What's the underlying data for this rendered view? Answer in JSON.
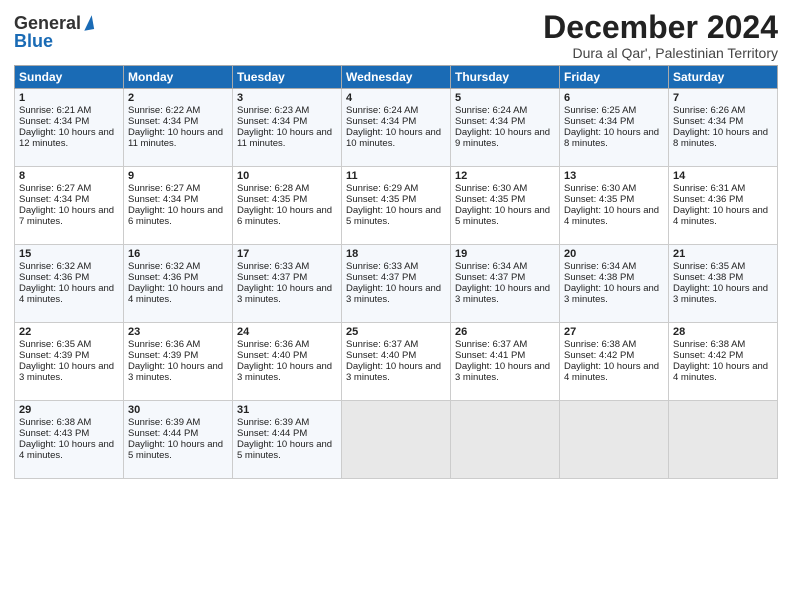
{
  "logo": {
    "general": "General",
    "blue": "Blue"
  },
  "title": {
    "month": "December 2024",
    "location": "Dura al Qar', Palestinian Territory"
  },
  "days_of_week": [
    "Sunday",
    "Monday",
    "Tuesday",
    "Wednesday",
    "Thursday",
    "Friday",
    "Saturday"
  ],
  "weeks": [
    [
      {
        "day": 1,
        "sunrise": "6:21 AM",
        "sunset": "4:34 PM",
        "daylight": "10 hours and 12 minutes."
      },
      {
        "day": 2,
        "sunrise": "6:22 AM",
        "sunset": "4:34 PM",
        "daylight": "10 hours and 11 minutes."
      },
      {
        "day": 3,
        "sunrise": "6:23 AM",
        "sunset": "4:34 PM",
        "daylight": "10 hours and 11 minutes."
      },
      {
        "day": 4,
        "sunrise": "6:24 AM",
        "sunset": "4:34 PM",
        "daylight": "10 hours and 10 minutes."
      },
      {
        "day": 5,
        "sunrise": "6:24 AM",
        "sunset": "4:34 PM",
        "daylight": "10 hours and 9 minutes."
      },
      {
        "day": 6,
        "sunrise": "6:25 AM",
        "sunset": "4:34 PM",
        "daylight": "10 hours and 8 minutes."
      },
      {
        "day": 7,
        "sunrise": "6:26 AM",
        "sunset": "4:34 PM",
        "daylight": "10 hours and 8 minutes."
      }
    ],
    [
      {
        "day": 8,
        "sunrise": "6:27 AM",
        "sunset": "4:34 PM",
        "daylight": "10 hours and 7 minutes."
      },
      {
        "day": 9,
        "sunrise": "6:27 AM",
        "sunset": "4:34 PM",
        "daylight": "10 hours and 6 minutes."
      },
      {
        "day": 10,
        "sunrise": "6:28 AM",
        "sunset": "4:35 PM",
        "daylight": "10 hours and 6 minutes."
      },
      {
        "day": 11,
        "sunrise": "6:29 AM",
        "sunset": "4:35 PM",
        "daylight": "10 hours and 5 minutes."
      },
      {
        "day": 12,
        "sunrise": "6:30 AM",
        "sunset": "4:35 PM",
        "daylight": "10 hours and 5 minutes."
      },
      {
        "day": 13,
        "sunrise": "6:30 AM",
        "sunset": "4:35 PM",
        "daylight": "10 hours and 4 minutes."
      },
      {
        "day": 14,
        "sunrise": "6:31 AM",
        "sunset": "4:36 PM",
        "daylight": "10 hours and 4 minutes."
      }
    ],
    [
      {
        "day": 15,
        "sunrise": "6:32 AM",
        "sunset": "4:36 PM",
        "daylight": "10 hours and 4 minutes."
      },
      {
        "day": 16,
        "sunrise": "6:32 AM",
        "sunset": "4:36 PM",
        "daylight": "10 hours and 4 minutes."
      },
      {
        "day": 17,
        "sunrise": "6:33 AM",
        "sunset": "4:37 PM",
        "daylight": "10 hours and 3 minutes."
      },
      {
        "day": 18,
        "sunrise": "6:33 AM",
        "sunset": "4:37 PM",
        "daylight": "10 hours and 3 minutes."
      },
      {
        "day": 19,
        "sunrise": "6:34 AM",
        "sunset": "4:37 PM",
        "daylight": "10 hours and 3 minutes."
      },
      {
        "day": 20,
        "sunrise": "6:34 AM",
        "sunset": "4:38 PM",
        "daylight": "10 hours and 3 minutes."
      },
      {
        "day": 21,
        "sunrise": "6:35 AM",
        "sunset": "4:38 PM",
        "daylight": "10 hours and 3 minutes."
      }
    ],
    [
      {
        "day": 22,
        "sunrise": "6:35 AM",
        "sunset": "4:39 PM",
        "daylight": "10 hours and 3 minutes."
      },
      {
        "day": 23,
        "sunrise": "6:36 AM",
        "sunset": "4:39 PM",
        "daylight": "10 hours and 3 minutes."
      },
      {
        "day": 24,
        "sunrise": "6:36 AM",
        "sunset": "4:40 PM",
        "daylight": "10 hours and 3 minutes."
      },
      {
        "day": 25,
        "sunrise": "6:37 AM",
        "sunset": "4:40 PM",
        "daylight": "10 hours and 3 minutes."
      },
      {
        "day": 26,
        "sunrise": "6:37 AM",
        "sunset": "4:41 PM",
        "daylight": "10 hours and 3 minutes."
      },
      {
        "day": 27,
        "sunrise": "6:38 AM",
        "sunset": "4:42 PM",
        "daylight": "10 hours and 4 minutes."
      },
      {
        "day": 28,
        "sunrise": "6:38 AM",
        "sunset": "4:42 PM",
        "daylight": "10 hours and 4 minutes."
      }
    ],
    [
      {
        "day": 29,
        "sunrise": "6:38 AM",
        "sunset": "4:43 PM",
        "daylight": "10 hours and 4 minutes."
      },
      {
        "day": 30,
        "sunrise": "6:39 AM",
        "sunset": "4:44 PM",
        "daylight": "10 hours and 5 minutes."
      },
      {
        "day": 31,
        "sunrise": "6:39 AM",
        "sunset": "4:44 PM",
        "daylight": "10 hours and 5 minutes."
      },
      null,
      null,
      null,
      null
    ]
  ]
}
